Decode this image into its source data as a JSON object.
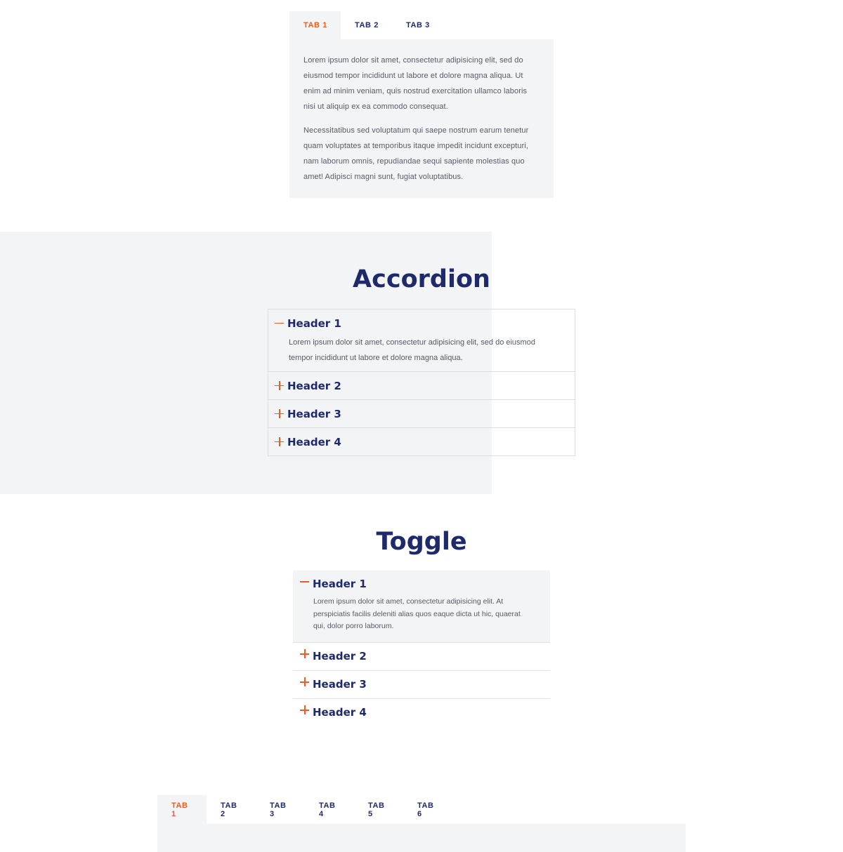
{
  "colors": {
    "accent": "#f05a22",
    "navy": "#1f2a6b",
    "panel": "#f3f4f6",
    "text": "#555a66"
  },
  "tabs_top": {
    "tabs": [
      "TAB 1",
      "TAB 2",
      "TAB 3"
    ],
    "active_index": 0,
    "paragraphs": [
      "Lorem ipsum dolor sit amet, consectetur adipisicing elit, sed do eiusmod tempor incididunt ut labore et dolore magna aliqua. Ut enim ad minim veniam, quis nostrud exercitation ullamco laboris nisi ut aliquip ex ea commodo consequat.",
      "Necessitatibus sed voluptatum qui saepe nostrum earum tenetur quam voluptates at temporibus itaque impedit incidunt excepturi, nam laborum omnis, repudiandae sequi sapiente molestias quo amet! Adipisci magni sunt, fugiat voluptatibus."
    ]
  },
  "accordion": {
    "title": "Accordion",
    "items": [
      {
        "header": "Header 1",
        "open": true,
        "body": "Lorem ipsum dolor sit amet, consectetur adipisicing elit, sed do eiusmod tempor incididunt ut labore et dolore magna aliqua."
      },
      {
        "header": "Header 2",
        "open": false
      },
      {
        "header": "Header 3",
        "open": false
      },
      {
        "header": "Header 4",
        "open": false
      }
    ]
  },
  "toggle": {
    "title": "Toggle",
    "items": [
      {
        "header": "Header 1",
        "open": true,
        "body": "Lorem ipsum dolor sit amet, consectetur adipisicing elit. At perspiciatis facilis deleniti alias quos eaque dicta ut hic, quaerat qui, dolor porro laborum."
      },
      {
        "header": "Header 2",
        "open": false
      },
      {
        "header": "Header 3",
        "open": false
      },
      {
        "header": "Header 4",
        "open": false
      }
    ]
  },
  "tabs_bottom": {
    "tabs": [
      "TAB 1",
      "TAB 2",
      "TAB 3",
      "TAB 4",
      "TAB 5",
      "TAB 6"
    ],
    "active_index": 0
  }
}
